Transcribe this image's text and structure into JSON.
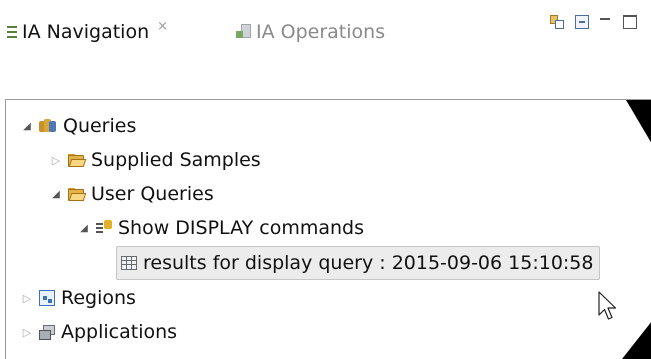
{
  "tabs": [
    {
      "label": "IA Navigation",
      "close_glyph": "×",
      "icon": "navigation-icon",
      "active": true
    },
    {
      "label": "IA Operations",
      "icon": "operations-icon",
      "active": false
    }
  ],
  "view_toolbar": {
    "icons": [
      "link-with-editor-icon",
      "collapse-all-icon",
      "minimize-icon",
      "maximize-icon"
    ]
  },
  "tree": {
    "queries": {
      "label": "Queries",
      "expanded": true,
      "icon": "queries-icon"
    },
    "supplied_samples": {
      "label": "Supplied Samples",
      "expanded": false,
      "icon": "folder-icon"
    },
    "user_queries": {
      "label": "User Queries",
      "expanded": true,
      "icon": "folder-icon"
    },
    "show_display": {
      "label": "Show DISPLAY commands",
      "expanded": true,
      "icon": "command-query-icon"
    },
    "results": {
      "label": "results for display query : 2015-09-06 15:10:58",
      "selected": true,
      "icon": "table-icon"
    },
    "regions": {
      "label": "Regions",
      "expanded": false,
      "icon": "regions-icon"
    },
    "applications": {
      "label": "Applications",
      "expanded": false,
      "icon": "applications-icon"
    }
  },
  "glyphs": {
    "expanded": "◢",
    "collapsed": "▷"
  },
  "colors": {
    "selection_bg": "#ececec",
    "folder": "#e5b24a",
    "corner_mark": "#000000"
  }
}
